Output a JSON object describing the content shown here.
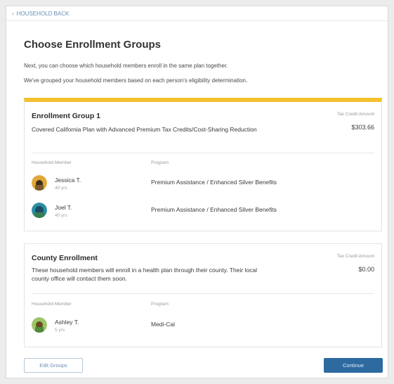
{
  "nav": {
    "back_label": "HOUSEHOLD BACK"
  },
  "page": {
    "title": "Choose Enrollment Groups",
    "intro_1": "Next, you can choose which household members enroll in the same plan together.",
    "intro_2": "We've grouped your household members based on each person's eligibility determination."
  },
  "groups": [
    {
      "title": "Enrollment Group 1",
      "description": "Covered California Plan with Advanced Premium Tax Credits/Cost-Sharing Reduction",
      "premium_label": "Tax Credit Amount",
      "premium_value": "$303.66",
      "col_member": "Household Member",
      "col_program": "Program",
      "members": [
        {
          "name": "Jessica T.",
          "age": "40 yrs",
          "program": "Premium Assistance / Enhanced Silver Benefits"
        },
        {
          "name": "Joel T.",
          "age": "40 yrs",
          "program": "Premium Assistance / Enhanced Silver Benefits"
        }
      ]
    },
    {
      "title": "County Enrollment",
      "description": "These household members will enroll in a health plan through their county. Their local county office will contact them soon.",
      "premium_label": "Tax Credit Amount",
      "premium_value": "$0.00",
      "col_member": "Household Member",
      "col_program": "Program",
      "members": [
        {
          "name": "Ashley T.",
          "age": "5 yrs",
          "program": "Medi-Cal"
        }
      ]
    }
  ],
  "actions": {
    "edit_label": "Edit Groups",
    "continue_label": "Continue"
  },
  "colors": {
    "accent_bar": "#f2c12e",
    "primary_button": "#2d6aa0",
    "link": "#6a8fb5"
  },
  "icons": {
    "back": "chevron-left-icon",
    "avatar": "avatar"
  }
}
